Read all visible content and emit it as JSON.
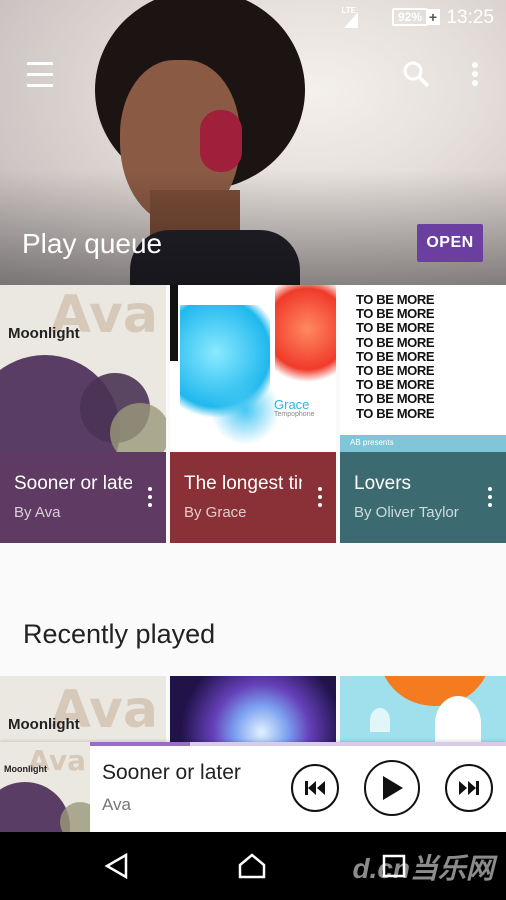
{
  "status_bar": {
    "network": "LTE",
    "battery": "92%",
    "time": "13:25"
  },
  "header": {
    "title": "Play queue",
    "open_label": "OPEN"
  },
  "queue": [
    {
      "title": "Sooner or later",
      "subtitle": "By Ava",
      "color": "#5f3a63",
      "art_text": "Moonlight",
      "art_big": "Ava"
    },
    {
      "title": "The longest time",
      "subtitle": "By Grace",
      "color": "#8a3137",
      "art_text": "Grace",
      "art_sub": "Tempophone"
    },
    {
      "title": "Lovers",
      "subtitle": "By Oliver Taylor",
      "color": "#3b6b71",
      "art_text": "TO BE MORE",
      "art_sub": "AB presents"
    }
  ],
  "recently_played": {
    "title": "Recently played",
    "items": [
      {
        "art_text": "Moonlight",
        "art_big": "Ava"
      },
      {
        "art_text": ""
      },
      {
        "art_text": ""
      }
    ]
  },
  "player": {
    "title": "Sooner or later",
    "artist": "Ava",
    "art_text": "Moonlight",
    "art_big": "Ava",
    "progress": 0.24
  },
  "watermark": "d.cn当乐网",
  "icons": {
    "menu": "hamburger-icon",
    "search": "search-icon",
    "overflow": "more-vert-icon",
    "prev": "skip-previous-icon",
    "play": "play-icon",
    "next": "skip-next-icon",
    "back": "back-icon",
    "home": "home-icon",
    "recents": "recents-icon"
  },
  "colors": {
    "accent": "#6b3fa0",
    "progress_fill": "#9b6cc7"
  }
}
